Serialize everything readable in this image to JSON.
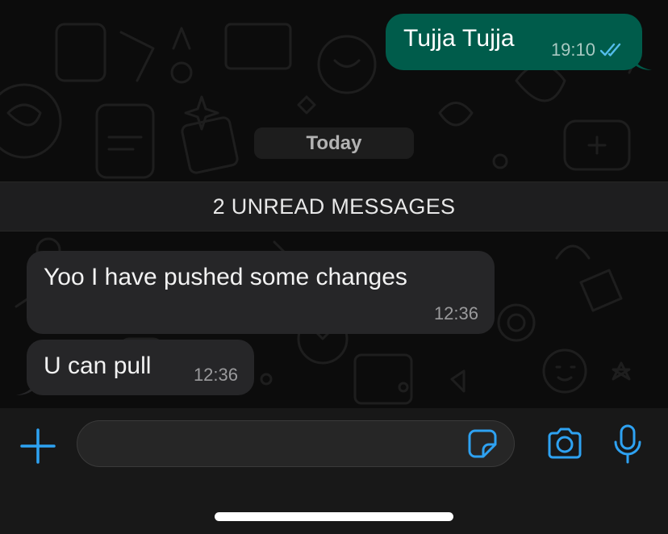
{
  "chat": {
    "outgoing": [
      {
        "text": "Tujja Tujja",
        "time": "19:10",
        "status": "read"
      }
    ],
    "date_separator": "Today",
    "unread_banner": "2 UNREAD MESSAGES",
    "incoming": [
      {
        "text": "Yoo I have pushed some changes",
        "time": "12:36"
      },
      {
        "text": "U can pull",
        "time": "12:36"
      }
    ]
  },
  "composer": {
    "value": "",
    "placeholder": "",
    "icons": [
      "plus-icon",
      "sticker-icon",
      "camera-icon",
      "microphone-icon"
    ]
  },
  "colors": {
    "outgoing_bubble": "#005c4b",
    "incoming_bubble": "#262628",
    "accent": "#2ea2f2",
    "read_ticks": "#53bdeb"
  }
}
